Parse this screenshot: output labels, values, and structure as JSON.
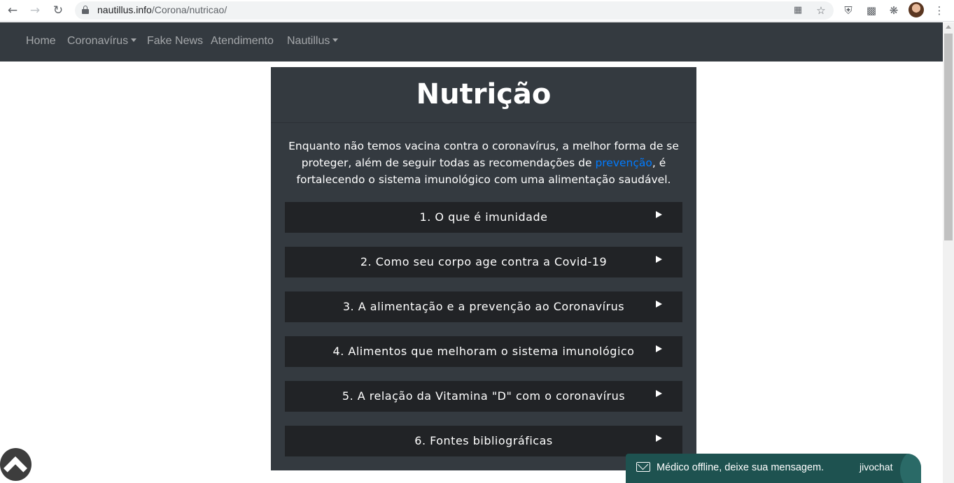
{
  "browser": {
    "url_domain": "nautillus.info",
    "url_path": "/Corona/nutricao/",
    "back_icon": "back-arrow-icon",
    "forward_icon": "forward-arrow-icon",
    "reload_icon": "reload-icon"
  },
  "navbar": {
    "items": [
      {
        "label": "Home"
      },
      {
        "label": "Coronavírus"
      },
      {
        "label": "Fake News"
      },
      {
        "label": "Atendimento"
      },
      {
        "label": "Nautillus"
      }
    ]
  },
  "main": {
    "title": "Nutrição",
    "intro_before": "Enquanto não temos vacina contra o coronavírus, a melhor forma de se proteger, além de seguir todas as recomendações de ",
    "intro_link": "prevenção",
    "intro_after": ", é fortalecendo o sistema imunológico com uma alimentação saudável.",
    "sections": [
      {
        "label": "1. O que é imunidade"
      },
      {
        "label": "2. Como seu corpo age contra a Covid-19"
      },
      {
        "label": "3. A alimentação e a prevenção ao Coronavírus"
      },
      {
        "label": "4. Alimentos que melhoram o sistema imunológico"
      },
      {
        "label": "5. A relação da Vitamina \"D\" com o coronavírus"
      },
      {
        "label": "6. Fontes bibliográficas"
      }
    ]
  },
  "chat": {
    "message": "Médico offline, deixe sua mensagem.",
    "brand": "jivochat"
  },
  "colors": {
    "navbar_bg": "#343a40",
    "card_bg": "#343a40",
    "accordion_bg": "#212326",
    "link": "#007bff",
    "chat_bg": "#1e5250"
  }
}
